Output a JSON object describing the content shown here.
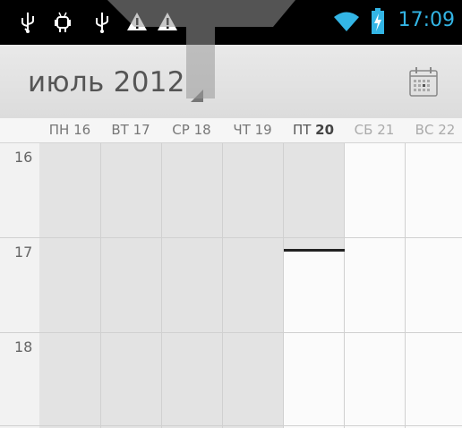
{
  "status_bar": {
    "icons_left": [
      "usb-icon",
      "android-debug-icon",
      "usb-icon",
      "warning-icon",
      "warning-icon"
    ],
    "icons_right": [
      "wifi-icon",
      "battery-charging-icon"
    ],
    "time": "17:09",
    "accent_color": "#33b5e5"
  },
  "action_bar": {
    "title": "июль 2012",
    "today_icon": "calendar-today-icon"
  },
  "week": {
    "days": [
      {
        "dow": "ПН",
        "num": "16",
        "weekend": false,
        "today": false
      },
      {
        "dow": "ВТ",
        "num": "17",
        "weekend": false,
        "today": false
      },
      {
        "dow": "СР",
        "num": "18",
        "weekend": false,
        "today": false
      },
      {
        "dow": "ЧТ",
        "num": "19",
        "weekend": false,
        "today": false
      },
      {
        "dow": "ПТ",
        "num": "20",
        "weekend": false,
        "today": true
      },
      {
        "dow": "СБ",
        "num": "21",
        "weekend": true,
        "today": false
      },
      {
        "dow": "ВС",
        "num": "22",
        "weekend": true,
        "today": false
      }
    ],
    "hours": [
      "16",
      "17",
      "18"
    ]
  }
}
